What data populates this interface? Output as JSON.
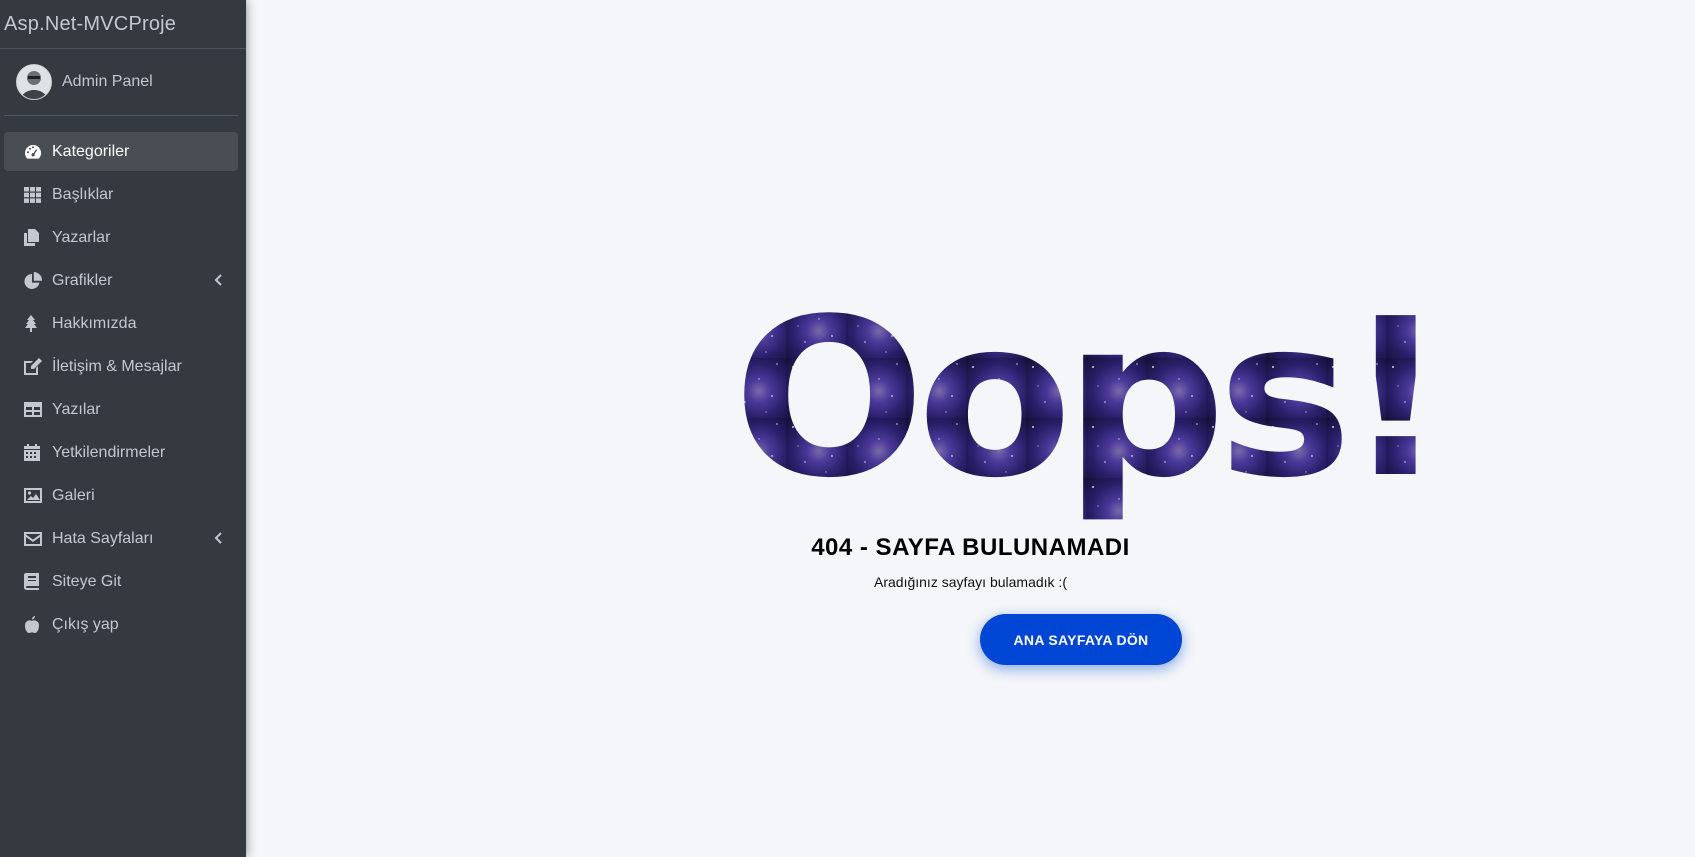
{
  "brand": {
    "title": "Asp.Net-MVCProje"
  },
  "user": {
    "name": "Admin Panel"
  },
  "sidebar": {
    "items": [
      {
        "label": "Kategoriler",
        "icon": "tachometer-icon",
        "active": true
      },
      {
        "label": "Başlıklar",
        "icon": "th-grid-icon"
      },
      {
        "label": "Yazarlar",
        "icon": "copy-icon"
      },
      {
        "label": "Grafikler",
        "icon": "chart-pie-icon",
        "has_submenu": true
      },
      {
        "label": "Hakkımızda",
        "icon": "tree-icon"
      },
      {
        "label": "İletişim & Mesajlar",
        "icon": "edit-icon"
      },
      {
        "label": "Yazılar",
        "icon": "table-icon"
      },
      {
        "label": "Yetkilendirmeler",
        "icon": "calendar-icon"
      },
      {
        "label": "Galeri",
        "icon": "image-icon"
      },
      {
        "label": "Hata Sayfaları",
        "icon": "envelope-icon",
        "has_submenu": true
      },
      {
        "label": "Siteye Git",
        "icon": "book-icon"
      },
      {
        "label": "Çıkış yap",
        "icon": "apple-icon"
      }
    ]
  },
  "error": {
    "headline": "Oops!",
    "title": "404 - SAYFA BULUNAMADI",
    "message": "Aradığınız sayfayı bulamadık :(",
    "button_label": "ANA SAYFAYA DÖN"
  },
  "colors": {
    "sidebar_bg": "#343a40",
    "page_bg": "#f4f6f9",
    "button_bg": "#0046d5",
    "galaxy_dark": "#1a1440",
    "galaxy_purple": "#4b3a9a"
  }
}
